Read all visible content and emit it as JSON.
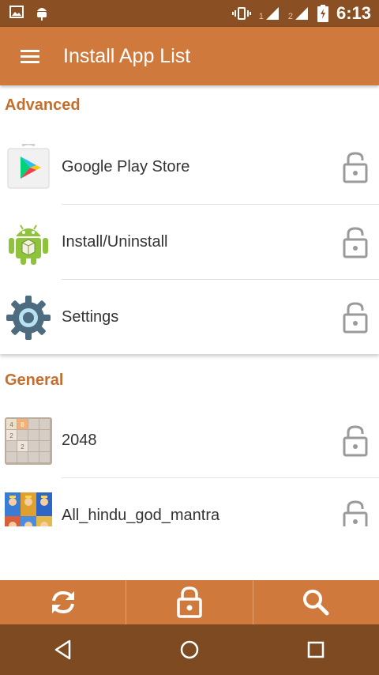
{
  "status_bar": {
    "time": "6:13",
    "sim1_label": "1",
    "sim2_label": "2",
    "icons": [
      "image-icon",
      "android-debug-icon",
      "vibrate-icon",
      "signal-icon",
      "signal-icon",
      "battery-charging-icon"
    ]
  },
  "app_bar": {
    "title": "Install App List",
    "menu_icon": "hamburger-menu-icon"
  },
  "sections": [
    {
      "header": "Advanced",
      "apps": [
        {
          "name": "Google Play Store",
          "icon": "google-play-store-icon",
          "locked": false
        },
        {
          "name": "Install/Uninstall",
          "icon": "android-robot-icon",
          "locked": false
        },
        {
          "name": "Settings",
          "icon": "settings-gear-icon",
          "locked": false
        }
      ]
    },
    {
      "header": "General",
      "apps": [
        {
          "name": "2048",
          "icon": "game-2048-icon",
          "locked": false
        },
        {
          "name": "All_hindu_god_mantra",
          "icon": "hindu-gods-icon",
          "locked": false
        }
      ]
    }
  ],
  "tile_2048": [
    "4",
    "8",
    "2",
    "2"
  ],
  "bottom_toolbar": {
    "buttons": [
      "refresh-icon",
      "lock-icon",
      "search-icon"
    ]
  },
  "nav_bar": {
    "buttons": [
      "back-icon",
      "home-icon",
      "recents-icon"
    ]
  },
  "colors": {
    "app_bar": "#cf7a3c",
    "status_bar": "#8a4f22",
    "nav_bar": "#7e4a22",
    "section_header": "#c56f2c",
    "lock_icon": "#9a9a9a"
  }
}
